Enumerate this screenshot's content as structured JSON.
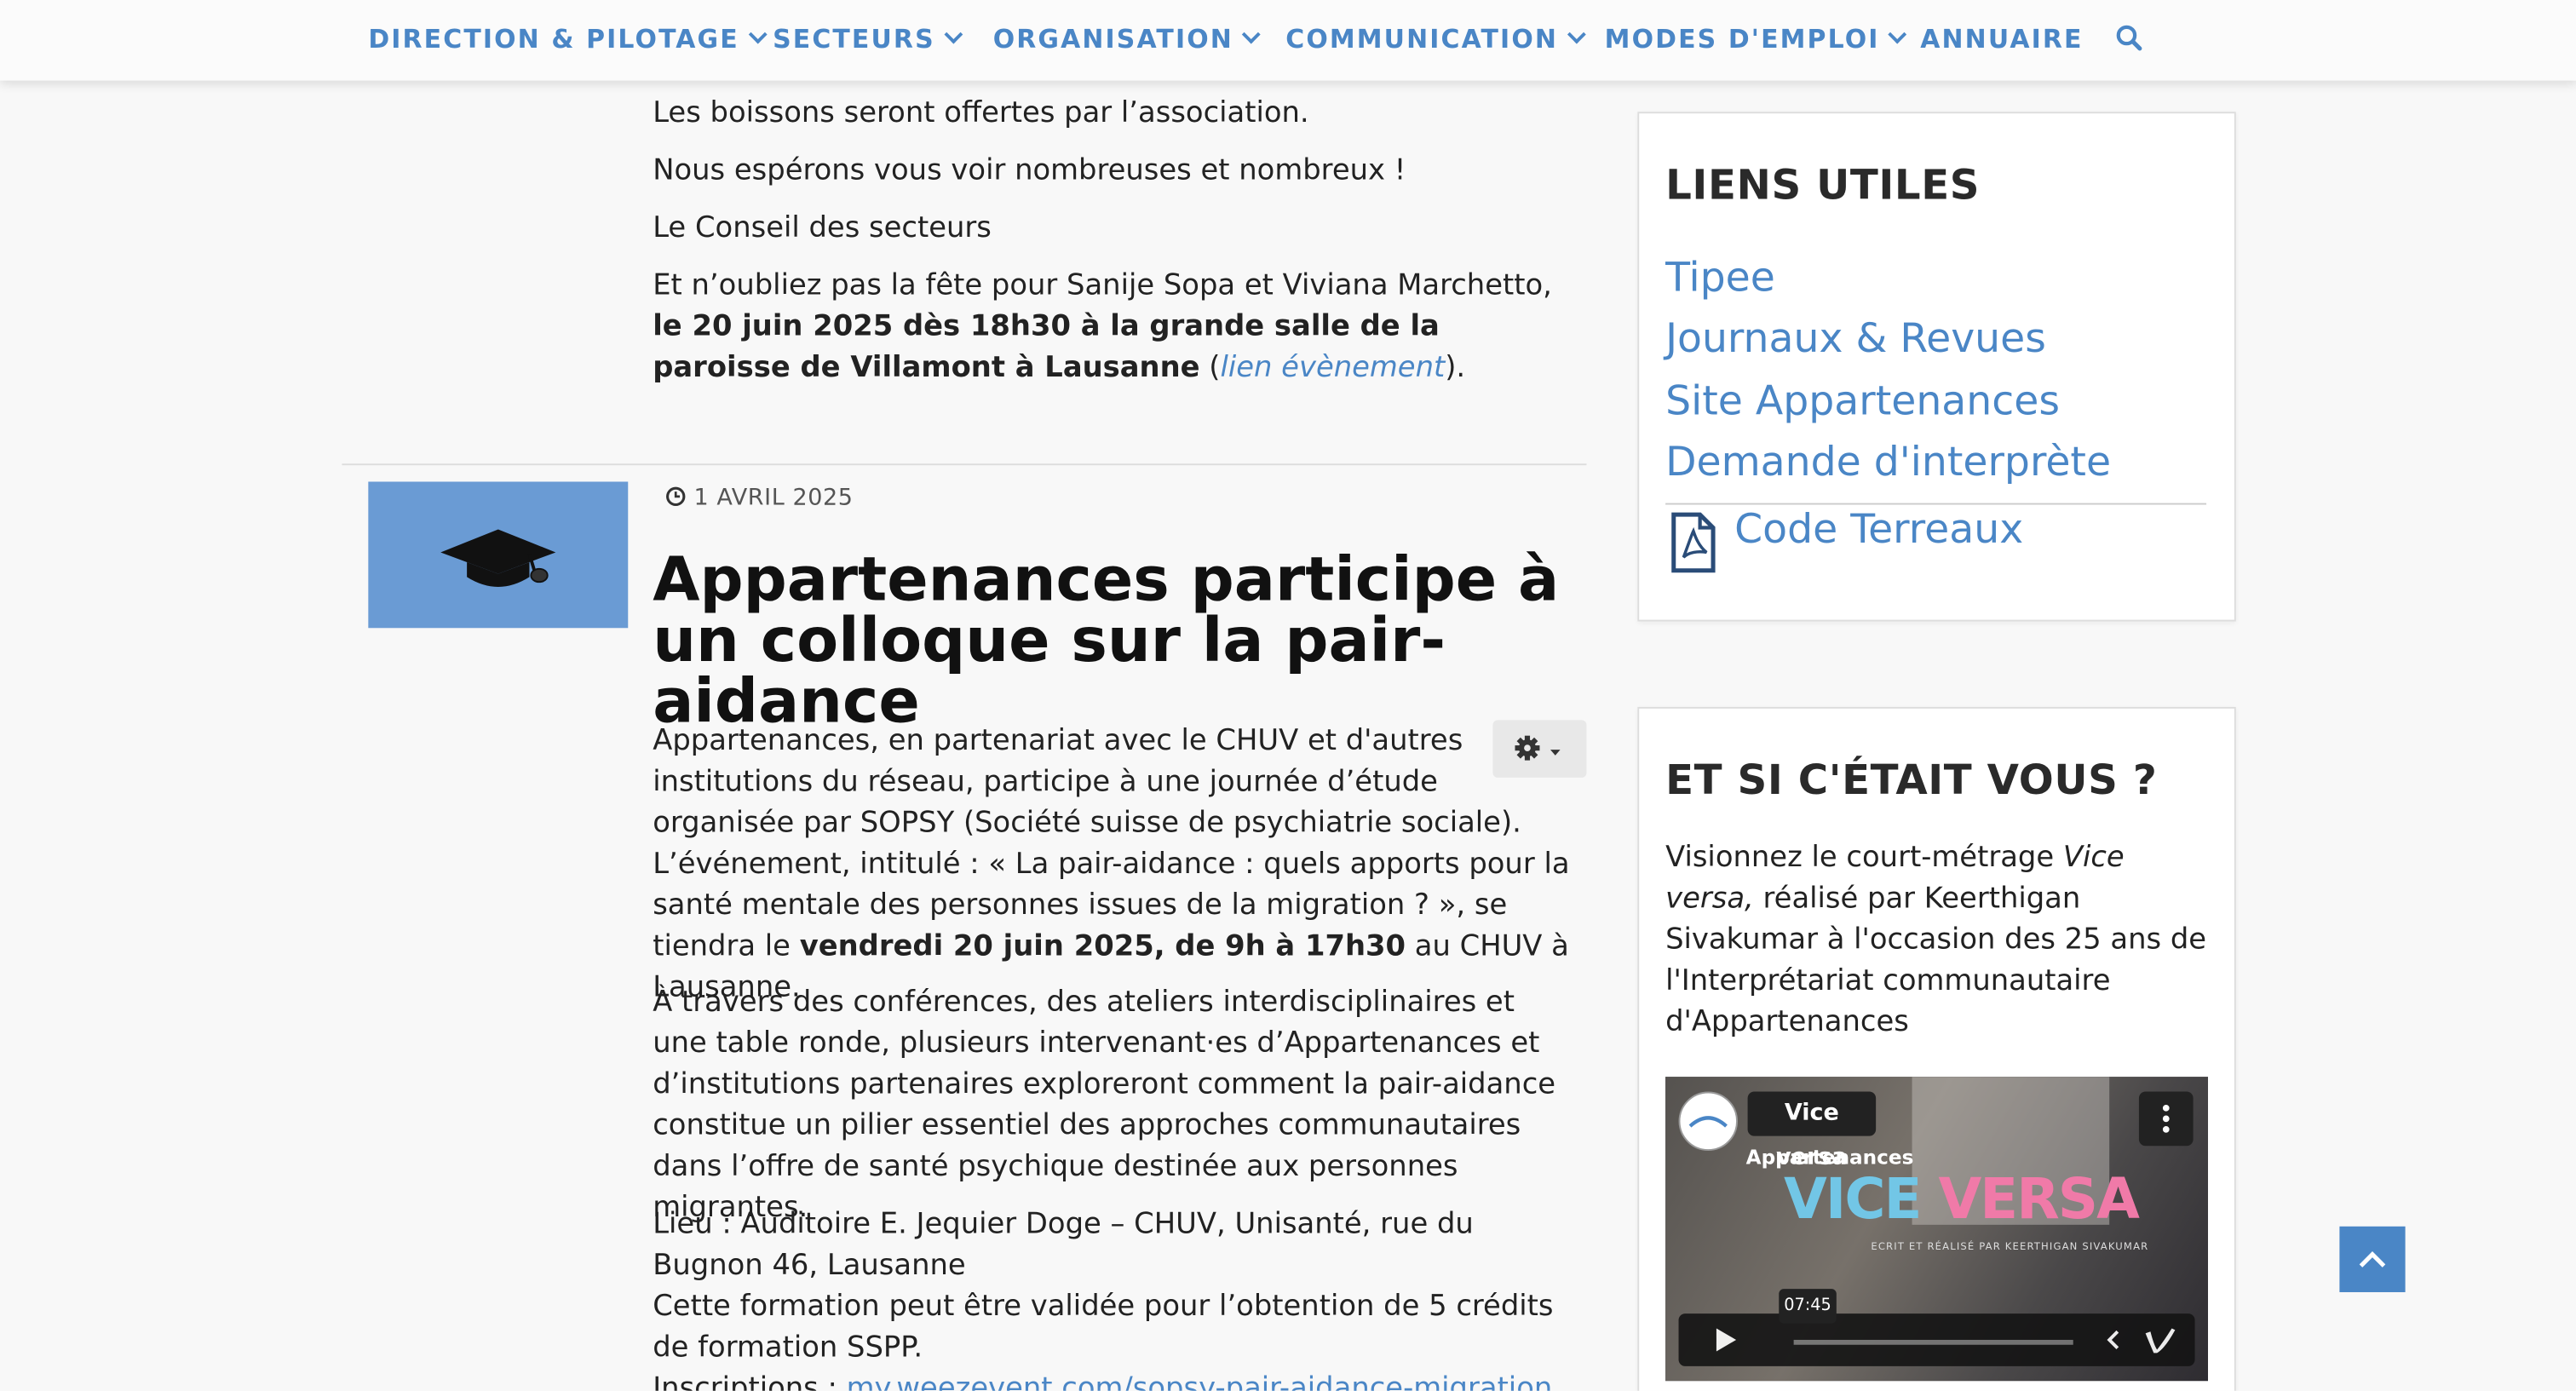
{
  "nav": {
    "items": [
      {
        "label": "DIRECTION & PILOTAGE"
      },
      {
        "label": "SECTEURS"
      },
      {
        "label": "ORGANISATION"
      },
      {
        "label": "COMMUNICATION"
      },
      {
        "label": "MODES D'EMPLOI"
      },
      {
        "label": "ANNUAIRE"
      }
    ],
    "search_icon": "search-icon"
  },
  "article1": {
    "p1": "Les boissons seront offertes par l’association.",
    "p2": "Nous espérons vous voir nombreuses et nombreux !",
    "p3": "Le Conseil des secteurs",
    "p4_pre": "Et n’oubliez pas la fête pour Sanije Sopa et Viviana Marchetto, ",
    "p4_bold": "le 20 juin 2025 dès 18h30 à la grande salle de la paroisse de Villamont à Lausanne",
    "p4_open": " (",
    "p4_link": "lien évènement",
    "p4_close": ")."
  },
  "article2": {
    "date": "1 AVRIL 2025",
    "thumb_icon": "graduation-cap-icon",
    "title": "Appartenances participe à un colloque sur la pair-aidance",
    "p1_pre": "Appartenances, en partenariat avec le CHUV et d'autres institutions du réseau, participe à une journée d’étude organisée par SOPSY (Société suisse de psychiatrie sociale). L’événement, intitulé : « La pair-aidance : quels apports pour la santé mentale des personnes issues de la migration ? », se tiendra le ",
    "p1_bold": "vendredi 20 juin 2025, de 9h à 17h30",
    "p1_post": " au CHUV à Lausanne.",
    "p2": "À travers des conférences, des ateliers interdisciplinaires et une table ronde, plusieurs intervenant·es d’Appartenances et d’institutions partenaires exploreront comment la pair-aidance constitue un pilier essentiel des approches communautaires dans l’offre de santé psychique destinée aux personnes migrantes.",
    "p3a": "Lieu : Auditoire E. Jequier Doge – CHUV, Unisanté, rue du Bugnon 46, Lausanne",
    "p3b": "Cette formation peut être validée pour l’obtention de 5 crédits de formation SSPP.",
    "p3c_label": "Inscriptions : ",
    "p3c_link": "my.weezevent.com/sopsy-pair-aidance-migration"
  },
  "sidebar": {
    "liens": {
      "title": "LIENS UTILES",
      "links": [
        "Tipee",
        "Journaux & Revues",
        "Site Appartenances",
        "Demande d'interprète"
      ],
      "pdf_link": "Code Terreaux"
    },
    "vous": {
      "title": "ET SI C'ÉTAIT VOUS ?",
      "text_pre": "Visionnez le court-métrage ",
      "text_em": "Vice versa,",
      "text_post": " réalisé par Keerthigan Sivakumar à l'occasion des 25 ans de l'Interprétariat communautaire d'Appartenances",
      "video": {
        "title": "Vice versa",
        "org": "Appartenances",
        "big1": "VICE ",
        "big2": "VERSA",
        "credit": "ECRIT ET RÉALISÉ PAR KEERTHIGAN SIVAKUMAR",
        "time": "07:45"
      }
    }
  },
  "colors": {
    "accent": "#4a86c6",
    "thumb": "#6a9bd4"
  }
}
